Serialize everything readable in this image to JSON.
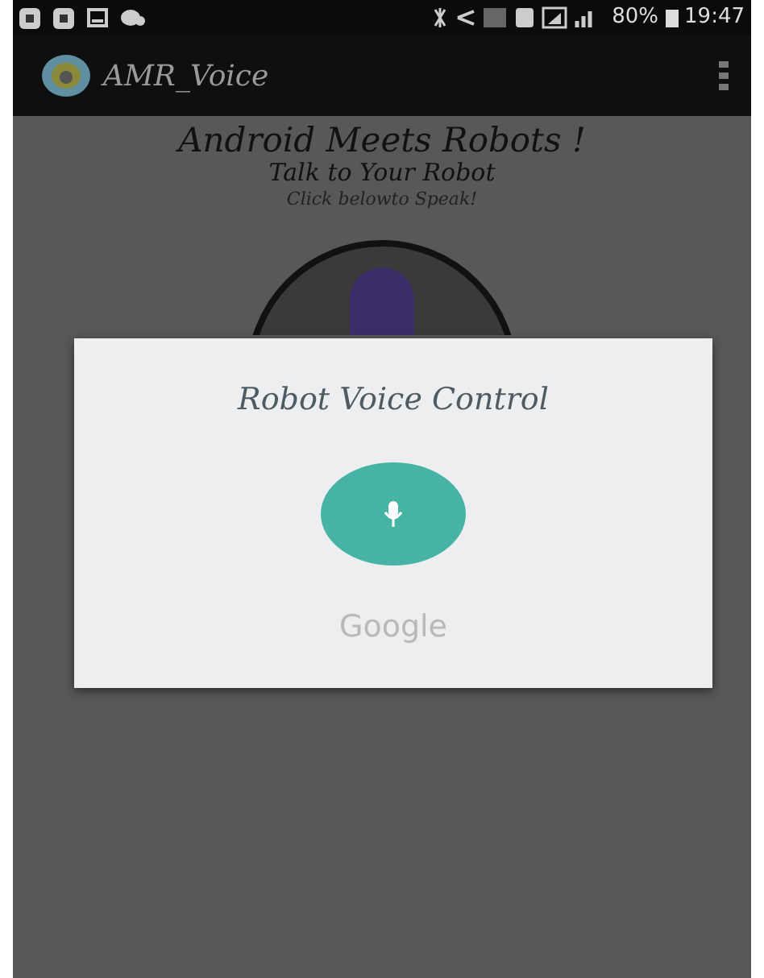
{
  "status_bar": {
    "battery": "80%",
    "time": "19:47"
  },
  "app_bar": {
    "title": "AMR_Voice"
  },
  "content": {
    "heading": "Android Meets Robots !",
    "subheading": "Talk to Your Robot",
    "hint": "Click belowto Speak!"
  },
  "dialog": {
    "title": "Robot Voice Control",
    "brand": "Google"
  }
}
